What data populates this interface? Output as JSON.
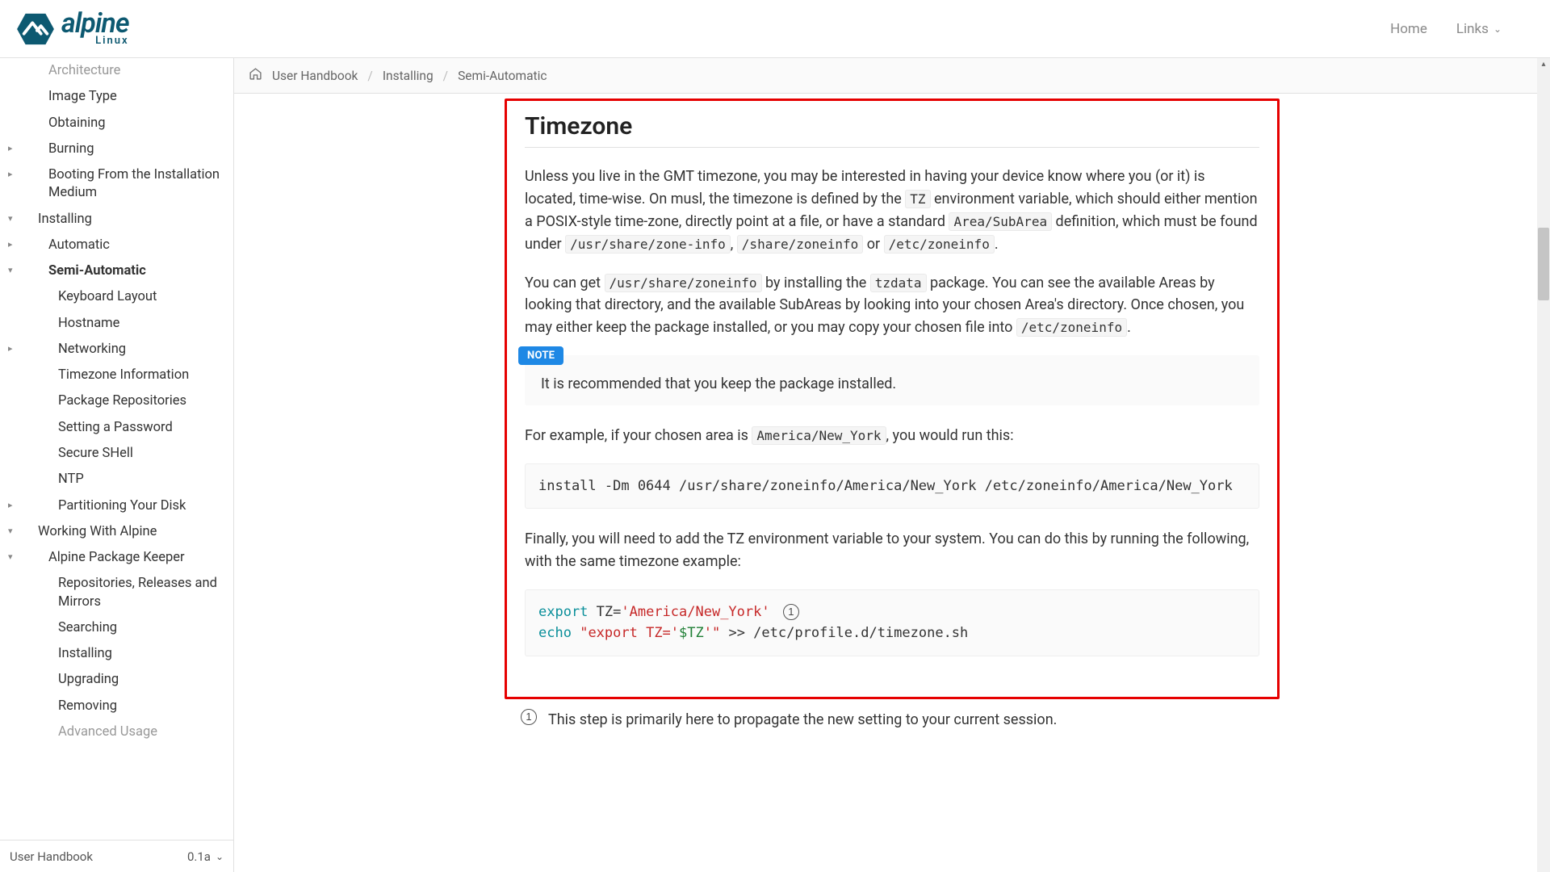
{
  "header": {
    "home_label": "Home",
    "links_label": "Links"
  },
  "sidebar": {
    "items": [
      {
        "label": "Architecture",
        "level": 1,
        "caret": "none",
        "cutoff": true
      },
      {
        "label": "Image Type",
        "level": 1,
        "caret": "none"
      },
      {
        "label": "Obtaining",
        "level": 1,
        "caret": "none"
      },
      {
        "label": "Burning",
        "level": 1,
        "caret": "right"
      },
      {
        "label": "Booting From the Installation Medium",
        "level": 1,
        "caret": "right"
      },
      {
        "label": "Installing",
        "level": 0,
        "caret": "down"
      },
      {
        "label": "Automatic",
        "level": 1,
        "caret": "right"
      },
      {
        "label": "Semi-Automatic",
        "level": 1,
        "caret": "down",
        "bold": true
      },
      {
        "label": "Keyboard Layout",
        "level": 2,
        "caret": "none"
      },
      {
        "label": "Hostname",
        "level": 2,
        "caret": "none"
      },
      {
        "label": "Networking",
        "level": 2,
        "caret": "right"
      },
      {
        "label": "Timezone Information",
        "level": 2,
        "caret": "none"
      },
      {
        "label": "Package Repositories",
        "level": 2,
        "caret": "none"
      },
      {
        "label": "Setting a Password",
        "level": 2,
        "caret": "none"
      },
      {
        "label": "Secure SHell",
        "level": 2,
        "caret": "none"
      },
      {
        "label": "NTP",
        "level": 2,
        "caret": "none"
      },
      {
        "label": "Partitioning Your Disk",
        "level": 2,
        "caret": "right"
      },
      {
        "label": "Working With Alpine",
        "level": 0,
        "caret": "down"
      },
      {
        "label": "Alpine Package Keeper",
        "level": 1,
        "caret": "down"
      },
      {
        "label": "Repositories, Releases and Mirrors",
        "level": 2,
        "caret": "none"
      },
      {
        "label": "Searching",
        "level": 2,
        "caret": "none"
      },
      {
        "label": "Installing",
        "level": 2,
        "caret": "none"
      },
      {
        "label": "Upgrading",
        "level": 2,
        "caret": "none"
      },
      {
        "label": "Removing",
        "level": 2,
        "caret": "none"
      },
      {
        "label": "Advanced Usage",
        "level": 2,
        "caret": "none",
        "cutoff": true
      }
    ],
    "book_name": "User Handbook",
    "version": "0.1a"
  },
  "breadcrumbs": [
    "User Handbook",
    "Installing",
    "Semi-Automatic"
  ],
  "article": {
    "title": "Timezone",
    "p1_a": "Unless you live in the GMT timezone, you may be interested in having your device know where you (or it) is located, time-wise. On musl, the timezone is defined by the ",
    "p1_code1": "TZ",
    "p1_b": " environment variable, which should either mention a POSIX-style time-zone, directly point at a file, or have a standard ",
    "p1_code2": "Area/SubArea",
    "p1_c": " definition, which must be found under ",
    "p1_code3": "/usr/share/zone-info",
    "p1_d": ", ",
    "p1_code4": "/share/zoneinfo",
    "p1_e": " or ",
    "p1_code5": "/etc/zoneinfo",
    "p1_f": ".",
    "p2_a": "You can get ",
    "p2_code1": "/usr/share/zoneinfo",
    "p2_b": " by installing the ",
    "p2_code2": "tzdata",
    "p2_c": " package. You can see the available Areas by looking that directory, and the available SubAreas by looking into your chosen Area's directory. Once chosen, you may either keep the package installed, or you may copy your chosen file into ",
    "p2_code3": "/etc/zoneinfo",
    "p2_d": ".",
    "note_label": "NOTE",
    "note_body": "It is recommended that you keep the package installed.",
    "p3_a": "For example, if your chosen area is ",
    "p3_code1": "America/New_York",
    "p3_b": ", you would run this:",
    "cb1": "install -Dm 0644 /usr/share/zoneinfo/America/New_York /etc/zoneinfo/America/New_York",
    "p4": "Finally, you will need to add the TZ environment variable to your system. You can do this by running the following, with the same timezone example:",
    "cb2": {
      "l1_kw": "export",
      "l1_rest": " TZ=",
      "l1_str": "'America/New_York'",
      "conum1": "1",
      "l2_kw": "echo",
      "l2_s1": "\"export TZ='",
      "l2_var": "$TZ",
      "l2_s2": "'\"",
      "l2_rest": " >> /etc/profile.d/timezone.sh"
    },
    "callout1_num": "1",
    "callout1_text": "This step is primarily here to propagate the new setting to your current session."
  }
}
